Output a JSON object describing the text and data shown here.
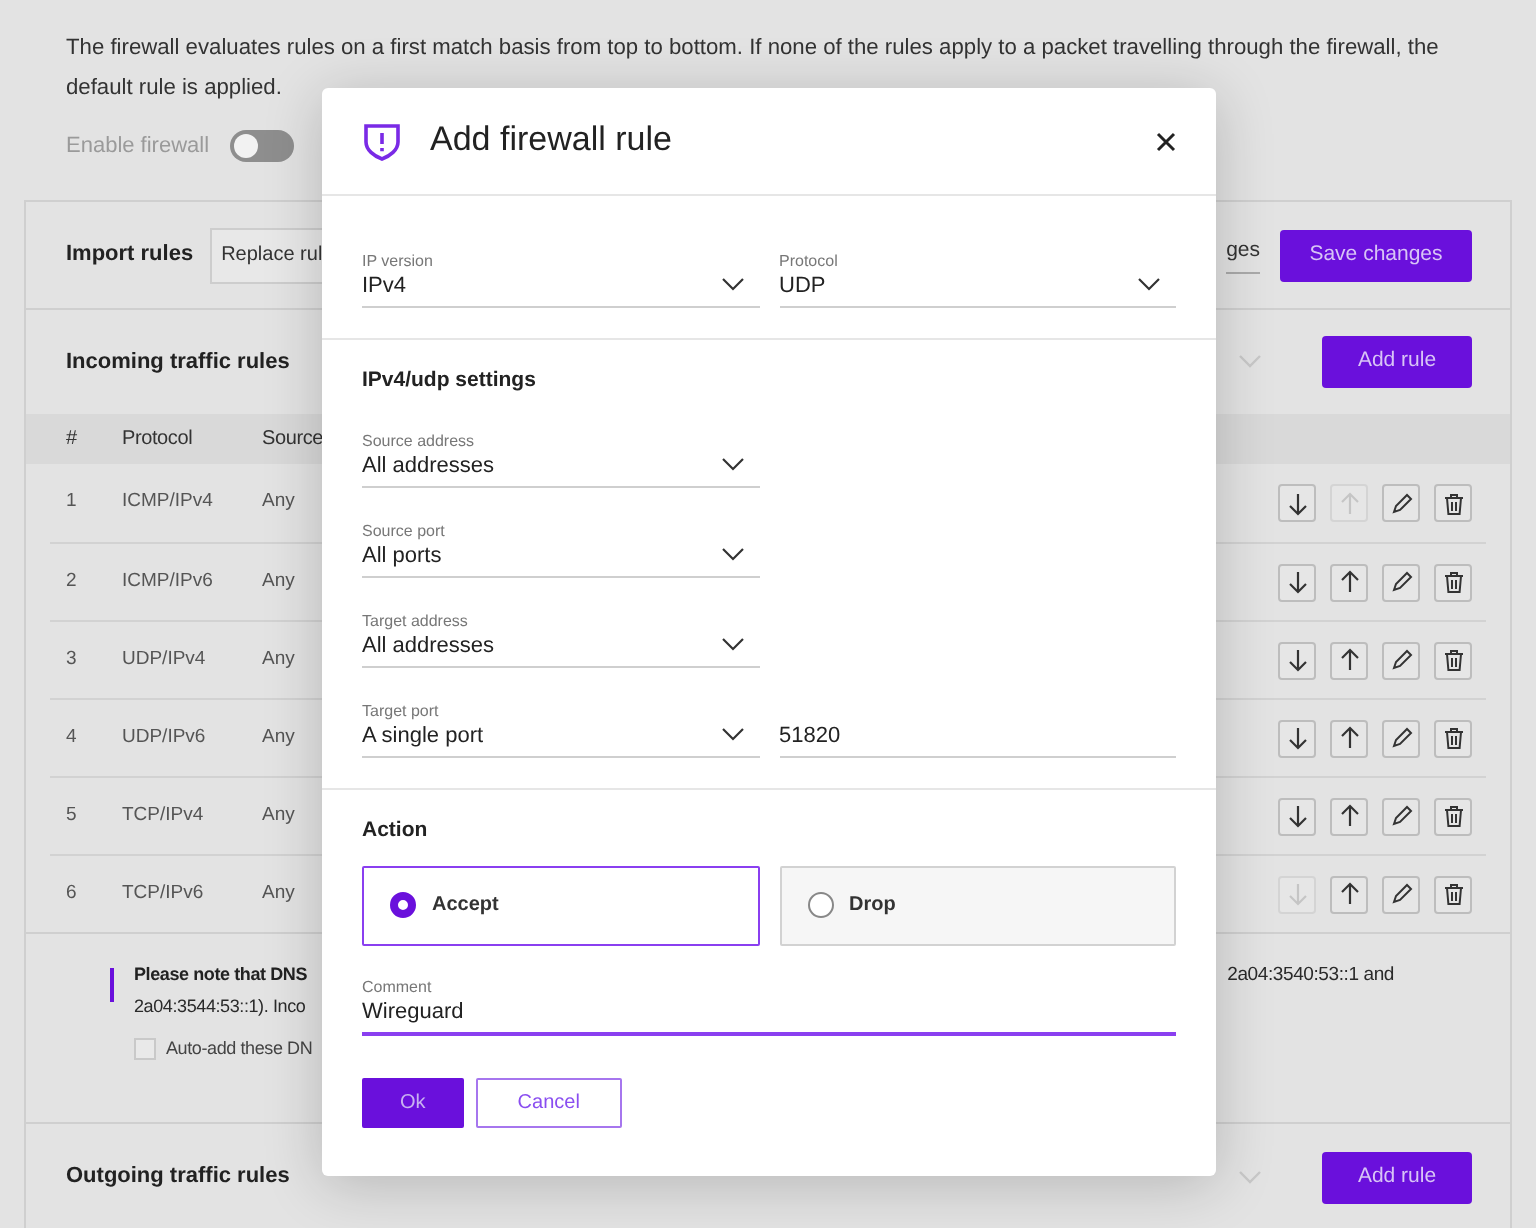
{
  "intro": "The firewall evaluates rules on a first match basis from top to bottom. If none of the rules apply to a packet travelling through the firewall, the default rule is applied.",
  "firewall_toggle": {
    "label": "Enable firewall",
    "on": false
  },
  "import": {
    "title": "Import rules",
    "replace_button": "Replace rul",
    "mode_select": "ges",
    "save_button": "Save changes"
  },
  "incoming": {
    "title": "Incoming traffic rules",
    "add_button": "Add rule",
    "columns": [
      "#",
      "Protocol",
      "Source"
    ],
    "rows": [
      {
        "number": "1",
        "protocol": "ICMP/IPv4",
        "source": "Any",
        "down_disabled": false,
        "up_disabled": true
      },
      {
        "number": "2",
        "protocol": "ICMP/IPv6",
        "source": "Any",
        "down_disabled": false,
        "up_disabled": false
      },
      {
        "number": "3",
        "protocol": "UDP/IPv4",
        "source": "Any",
        "down_disabled": false,
        "up_disabled": false
      },
      {
        "number": "4",
        "protocol": "UDP/IPv6",
        "source": "Any",
        "down_disabled": false,
        "up_disabled": false
      },
      {
        "number": "5",
        "protocol": "TCP/IPv4",
        "source": "Any",
        "down_disabled": false,
        "up_disabled": false
      },
      {
        "number": "6",
        "protocol": "TCP/IPv6",
        "source": "Any",
        "down_disabled": true,
        "up_disabled": false
      }
    ]
  },
  "dns_note": {
    "line_1": "Please note that DNS",
    "line_1_end": "2a04:3540:53::1 and",
    "line_2": "2a04:3544:53::1). Inco",
    "checkbox": {
      "label": "Auto-add these DN",
      "checked": false
    }
  },
  "outgoing": {
    "title": "Outgoing traffic rules",
    "add_button": "Add rule"
  },
  "dialog": {
    "title": "Add firewall rule",
    "top_fields": [
      {
        "label": "IP version",
        "value": "IPv4"
      },
      {
        "label": "Protocol",
        "value": "UDP"
      }
    ],
    "settings_title": "IPv4/udp settings",
    "settings_fields": [
      {
        "label": "Source address",
        "value": "All addresses"
      },
      {
        "label": "Source port",
        "value": "All ports"
      },
      {
        "label": "Target address",
        "value": "All addresses"
      },
      {
        "label": "Target port",
        "value": "A single port",
        "extra_value": "51820"
      }
    ],
    "action_title": "Action",
    "actions": [
      {
        "label": "Accept",
        "selected": true
      },
      {
        "label": "Drop",
        "selected": false
      }
    ],
    "comment": {
      "label": "Comment",
      "value": "Wireguard"
    },
    "buttons": [
      {
        "label": "Ok",
        "kind": "primary"
      },
      {
        "label": "Cancel",
        "kind": "outline"
      }
    ]
  }
}
